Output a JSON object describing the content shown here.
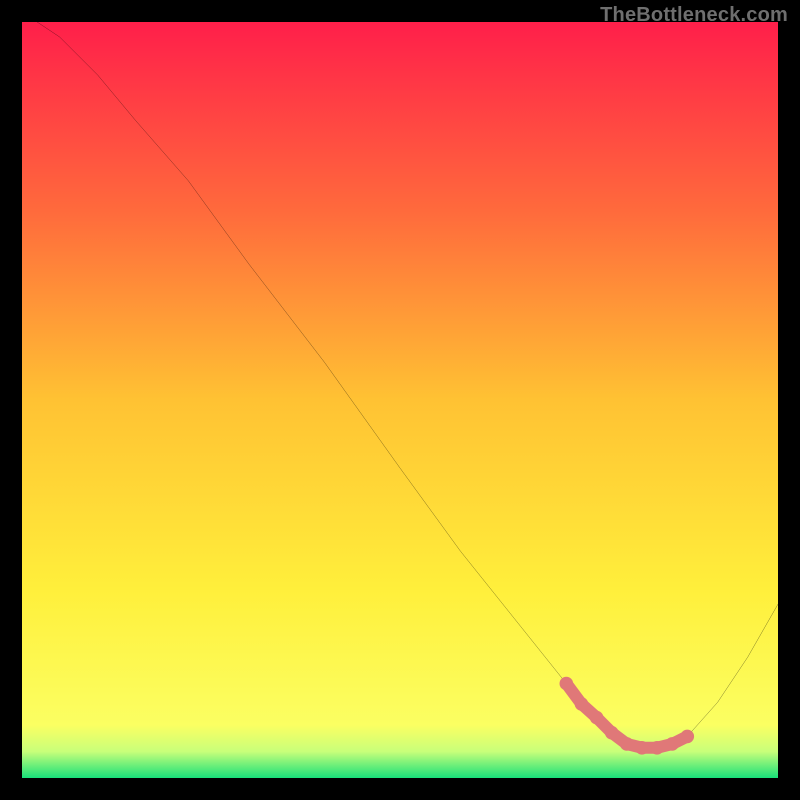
{
  "watermark": {
    "text": "TheBottleneck.com"
  },
  "gradient": {
    "stops": [
      {
        "offset": 0.0,
        "color": "#ff1f4a"
      },
      {
        "offset": 0.25,
        "color": "#ff6a3c"
      },
      {
        "offset": 0.5,
        "color": "#ffc233"
      },
      {
        "offset": 0.75,
        "color": "#ffef3b"
      },
      {
        "offset": 0.93,
        "color": "#fbff62"
      },
      {
        "offset": 0.965,
        "color": "#c8ff7a"
      },
      {
        "offset": 1.0,
        "color": "#18e07a"
      }
    ]
  },
  "chart_data": {
    "type": "line",
    "title": "",
    "xlabel": "",
    "ylabel": "",
    "xlim": [
      0,
      100
    ],
    "ylim": [
      0,
      100
    ],
    "series": [
      {
        "name": "main-curve",
        "x": [
          2,
          5,
          10,
          15,
          22,
          30,
          40,
          50,
          58,
          66,
          72,
          76,
          78,
          80,
          82,
          84,
          86,
          88,
          92,
          96,
          100
        ],
        "y": [
          100,
          98,
          93,
          87,
          79,
          68,
          55,
          41,
          30,
          20,
          12.5,
          8,
          6,
          4.5,
          4,
          4,
          4.5,
          5.5,
          10,
          16,
          23
        ]
      }
    ],
    "highlight_band": {
      "name": "bottleneck-band",
      "color": "#e07878",
      "x": [
        72,
        74,
        76,
        78,
        80,
        82,
        84,
        86,
        88
      ],
      "y": [
        12.5,
        9.8,
        8,
        6,
        4.5,
        4,
        4,
        4.5,
        5.5
      ]
    }
  }
}
